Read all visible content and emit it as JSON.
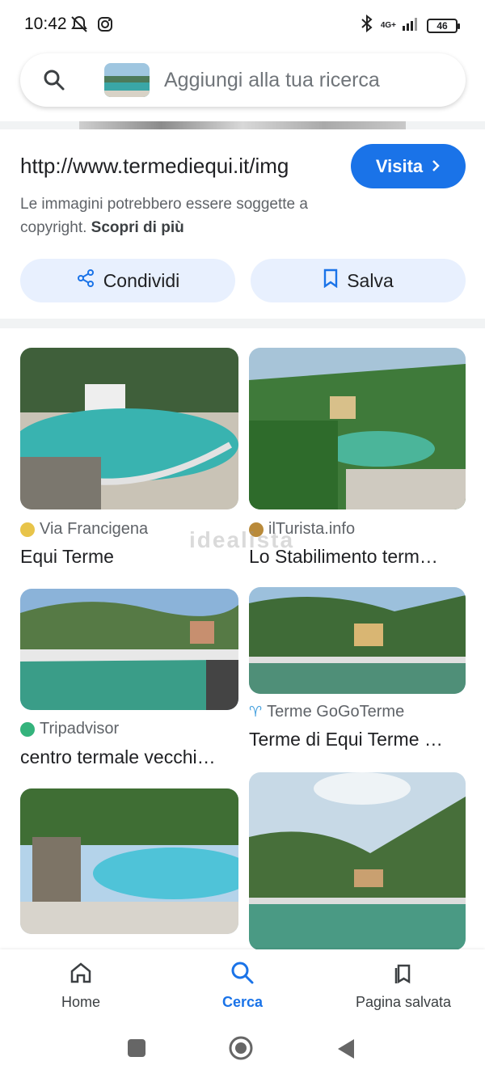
{
  "status_bar": {
    "time": "10:42",
    "network": "4G+",
    "battery": "46",
    "icons": [
      "mute-icon",
      "instagram-icon",
      "bluetooth-icon",
      "signal-icon",
      "battery-icon"
    ]
  },
  "search": {
    "placeholder": "Aggiungi alla tua ricerca"
  },
  "detail": {
    "url": "http://www.termediequi.it/img",
    "visit_label": "Visita",
    "copyright_text": "Le immagini potrebbero essere soggette a copyright.",
    "learn_more": "Scopri di più",
    "share_label": "Condividi",
    "save_label": "Salva"
  },
  "watermark": "idealista",
  "results": [
    {
      "source": "Via Francigena",
      "title": "Equi Terme"
    },
    {
      "source": "ilTurista.info",
      "title": "Lo Stabilimento term…"
    },
    {
      "source": "Tripadvisor",
      "title": "centro termale vecchi…"
    },
    {
      "source": "Terme GoGoTerme",
      "title": "Terme di Equi Terme …"
    }
  ],
  "bottom_nav": {
    "home": "Home",
    "search": "Cerca",
    "saved": "Pagina salvata"
  },
  "colors": {
    "accent": "#1a73e8",
    "chip_bg": "#e8f0fe"
  }
}
